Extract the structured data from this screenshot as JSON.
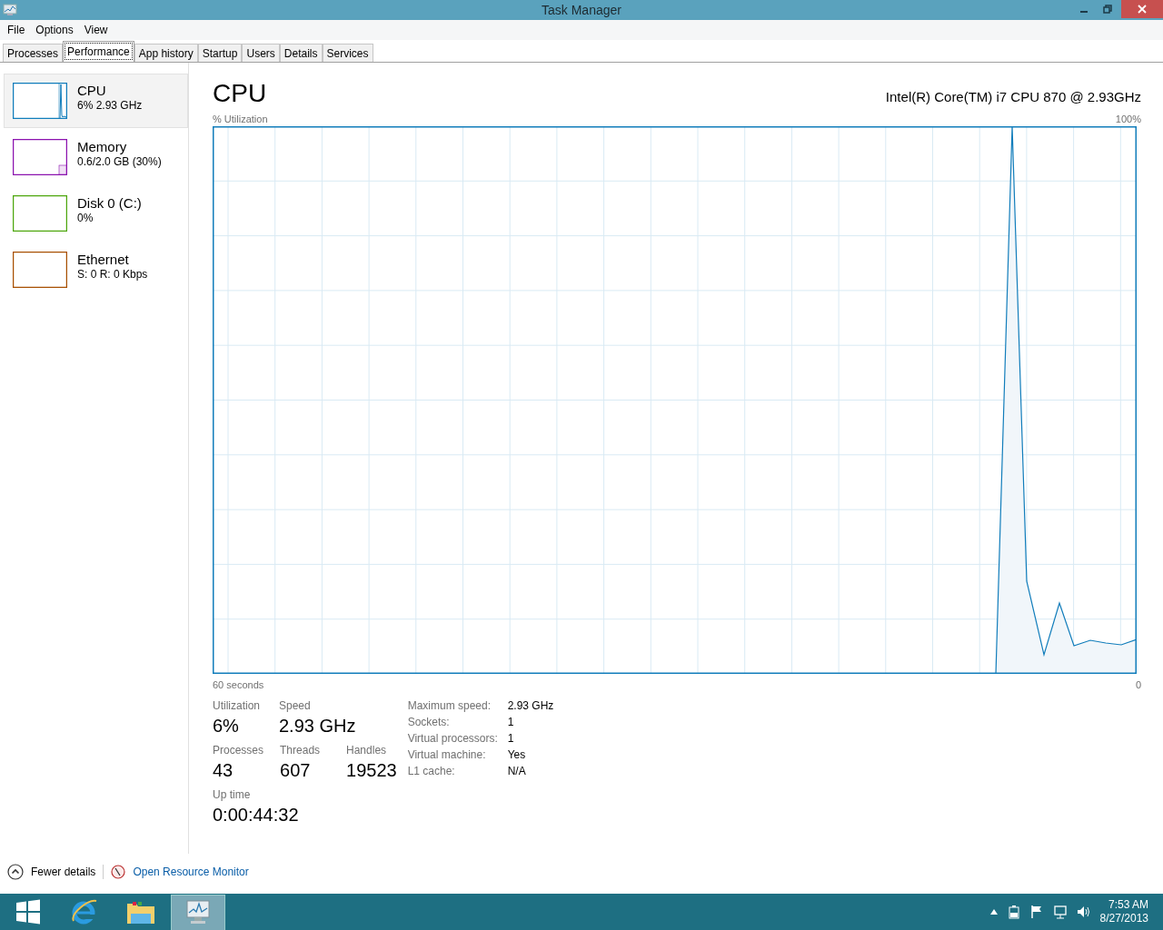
{
  "window": {
    "title": "Task Manager"
  },
  "menu": [
    "File",
    "Options",
    "View"
  ],
  "tabs": [
    {
      "label": "Processes",
      "selected": false
    },
    {
      "label": "Performance",
      "selected": true
    },
    {
      "label": "App history",
      "selected": false
    },
    {
      "label": "Startup",
      "selected": false
    },
    {
      "label": "Users",
      "selected": false
    },
    {
      "label": "Details",
      "selected": false
    },
    {
      "label": "Services",
      "selected": false
    }
  ],
  "sidebar": {
    "items": [
      {
        "kind": "cpu",
        "name": "CPU",
        "detail": "6% 2.93 GHz",
        "color": "#117dbb",
        "selected": true
      },
      {
        "kind": "memory",
        "name": "Memory",
        "detail": "0.6/2.0 GB (30%)",
        "color": "#8b12ae",
        "selected": false
      },
      {
        "kind": "disk",
        "name": "Disk 0 (C:)",
        "detail": "0%",
        "color": "#4da60c",
        "selected": false
      },
      {
        "kind": "network",
        "name": "Ethernet",
        "detail": "S: 0 R: 0 Kbps",
        "color": "#a74f01",
        "selected": false
      }
    ]
  },
  "performance": {
    "title": "CPU",
    "processor": "Intel(R) Core(TM) i7 CPU 870 @ 2.93GHz",
    "y_label": "% Utilization",
    "y_max": "100%",
    "x_start": "60 seconds",
    "x_end": "0",
    "stat_rows": [
      [
        {
          "label": "Utilization",
          "value": "6%"
        },
        {
          "label": "Speed",
          "value": "2.93 GHz"
        }
      ],
      [
        {
          "label": "Processes",
          "value": "43"
        },
        {
          "label": "Threads",
          "value": "607"
        },
        {
          "label": "Handles",
          "value": "19523"
        }
      ],
      [
        {
          "label": "Up time",
          "value": "0:00:44:32"
        }
      ]
    ],
    "specs": [
      {
        "key": "Maximum speed:",
        "value": "2.93 GHz"
      },
      {
        "key": "Sockets:",
        "value": "1"
      },
      {
        "key": "Virtual processors:",
        "value": "1"
      },
      {
        "key": "Virtual machine:",
        "value": "Yes"
      },
      {
        "key": "L1 cache:",
        "value": "N/A"
      }
    ]
  },
  "footer": {
    "fewer_details": "Fewer details",
    "resource_monitor": "Open Resource Monitor"
  },
  "taskbar": {
    "apps": [
      {
        "kind": "start",
        "selected": false
      },
      {
        "kind": "browser",
        "selected": false
      },
      {
        "kind": "folder",
        "selected": false
      },
      {
        "kind": "monitor",
        "selected": true
      }
    ],
    "clock": {
      "time": "7:53 AM",
      "date": "8/27/2013"
    }
  }
}
